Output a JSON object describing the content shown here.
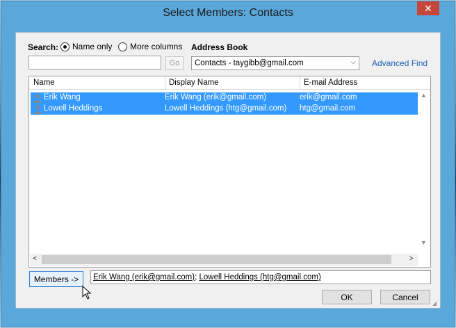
{
  "window": {
    "title": "Select Members: Contacts",
    "close_glyph": "✕"
  },
  "search": {
    "label": "Search:",
    "value": "",
    "radio_name_only": "Name only",
    "radio_more_columns": "More columns",
    "selected_mode": "Name only",
    "go_label": "Go"
  },
  "address_book": {
    "label": "Address Book",
    "selected": "Contacts - taygibb@gmail.com",
    "advanced_find": "Advanced Find"
  },
  "table": {
    "columns": [
      "Name",
      "Display Name",
      "E-mail Address"
    ],
    "rows": [
      {
        "name": "Erik Wang",
        "display_name": "Erik Wang (erik@gmail.com)",
        "email": "erik@gmail.com",
        "selected": true
      },
      {
        "name": "Lowell Heddings",
        "display_name": "Lowell Heddings (htg@gmail.com)",
        "email": "htg@gmail.com",
        "selected": true
      }
    ]
  },
  "members": {
    "button_label": "Members ->",
    "entry_1": "Erik Wang (erik@gmail.com)",
    "separator": "; ",
    "entry_2": "Lowell Heddings (htg@gmail.com)"
  },
  "buttons": {
    "ok": "OK",
    "cancel": "Cancel"
  },
  "colors": {
    "titlebar": "#5aa7da",
    "selection": "#3399ff",
    "close": "#c7463a",
    "link": "#2060b8"
  },
  "icons": {
    "contact": "person-icon",
    "cursor": "mouse-pointer-icon"
  }
}
